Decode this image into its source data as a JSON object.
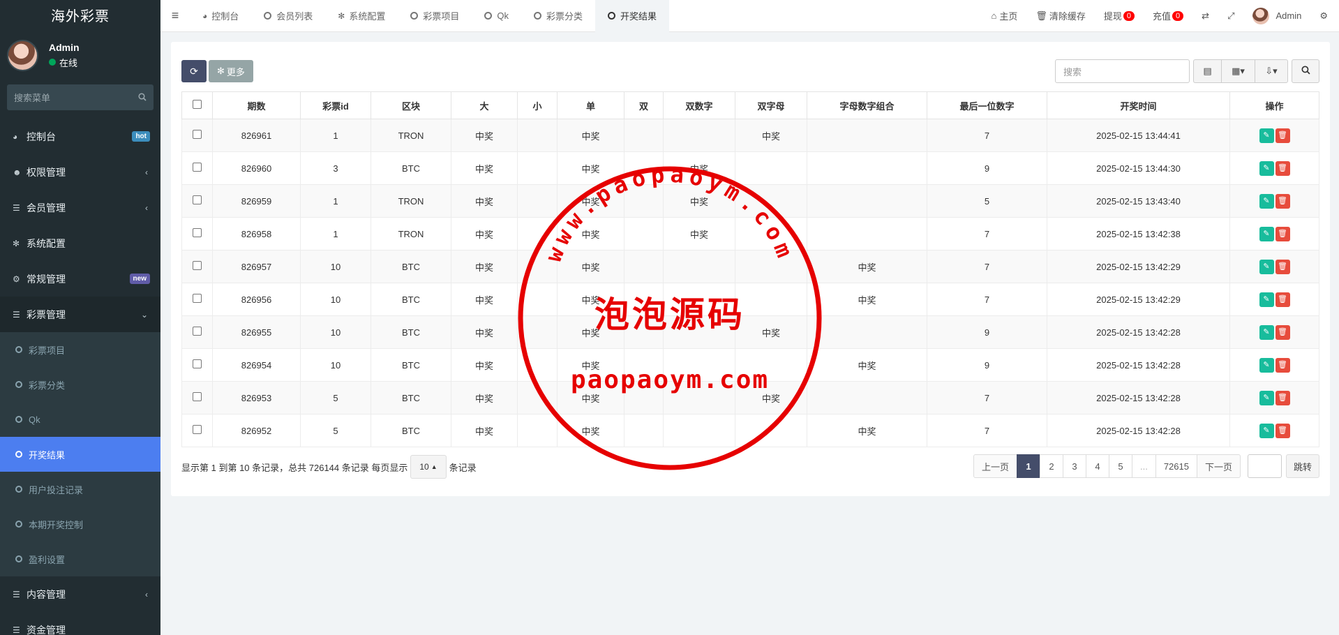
{
  "app": {
    "title": "海外彩票"
  },
  "user": {
    "name": "Admin",
    "status": "在线"
  },
  "sidebar": {
    "search_placeholder": "搜索菜单",
    "items": [
      {
        "label": "控制台",
        "icon": "dashboard-icon",
        "badge": "hot"
      },
      {
        "label": "权限管理",
        "icon": "users-icon",
        "arrow": "‹"
      },
      {
        "label": "会员管理",
        "icon": "list-icon",
        "arrow": "‹"
      },
      {
        "label": "系统配置",
        "icon": "gear-icon"
      },
      {
        "label": "常规管理",
        "icon": "cogs-icon",
        "badge": "new"
      },
      {
        "label": "彩票管理",
        "icon": "list-icon",
        "arrow": "⌄"
      }
    ],
    "sub_items": [
      {
        "label": "彩票项目"
      },
      {
        "label": "彩票分类"
      },
      {
        "label": "Qk"
      },
      {
        "label": "开奖结果"
      },
      {
        "label": "用户投注记录"
      },
      {
        "label": "本期开奖控制"
      },
      {
        "label": "盈利设置"
      }
    ],
    "bottom_items": [
      {
        "label": "内容管理",
        "icon": "list-icon",
        "arrow": "‹"
      },
      {
        "label": "资金管理",
        "icon": "list-icon"
      }
    ]
  },
  "topnav": {
    "tabs": [
      {
        "label": "控制台",
        "icon": "dashboard-icon"
      },
      {
        "label": "会员列表"
      },
      {
        "label": "系统配置",
        "icon": "gear-icon"
      },
      {
        "label": "彩票项目"
      },
      {
        "label": "Qk"
      },
      {
        "label": "彩票分类"
      },
      {
        "label": "开奖结果"
      }
    ],
    "right": {
      "home": "主页",
      "clear_cache": "清除缓存",
      "withdraw": "提现",
      "withdraw_count": "0",
      "recharge": "充值",
      "recharge_count": "0",
      "user": "Admin"
    }
  },
  "toolbar": {
    "more": "更多",
    "search_placeholder": "搜索"
  },
  "table": {
    "headers": [
      "期数",
      "彩票id",
      "区块",
      "大",
      "小",
      "单",
      "双",
      "双数字",
      "双字母",
      "字母数字组合",
      "最后一位数字",
      "开奖时间",
      "操作"
    ],
    "rows": [
      [
        "826961",
        "1",
        "TRON",
        "中奖",
        "",
        "中奖",
        "",
        "",
        "中奖",
        "",
        "7",
        "2025-02-15 13:44:41"
      ],
      [
        "826960",
        "3",
        "BTC",
        "中奖",
        "",
        "中奖",
        "",
        "中奖",
        "",
        "",
        "9",
        "2025-02-15 13:44:30"
      ],
      [
        "826959",
        "1",
        "TRON",
        "中奖",
        "",
        "中奖",
        "",
        "中奖",
        "",
        "",
        "5",
        "2025-02-15 13:43:40"
      ],
      [
        "826958",
        "1",
        "TRON",
        "中奖",
        "",
        "中奖",
        "",
        "中奖",
        "",
        "",
        "7",
        "2025-02-15 13:42:38"
      ],
      [
        "826957",
        "10",
        "BTC",
        "中奖",
        "",
        "中奖",
        "",
        "",
        "",
        "中奖",
        "7",
        "2025-02-15 13:42:29"
      ],
      [
        "826956",
        "10",
        "BTC",
        "中奖",
        "",
        "中奖",
        "",
        "",
        "",
        "中奖",
        "7",
        "2025-02-15 13:42:29"
      ],
      [
        "826955",
        "10",
        "BTC",
        "中奖",
        "",
        "中奖",
        "",
        "",
        "中奖",
        "",
        "9",
        "2025-02-15 13:42:28"
      ],
      [
        "826954",
        "10",
        "BTC",
        "中奖",
        "",
        "中奖",
        "",
        "",
        "",
        "中奖",
        "9",
        "2025-02-15 13:42:28"
      ],
      [
        "826953",
        "5",
        "BTC",
        "中奖",
        "",
        "中奖",
        "",
        "",
        "中奖",
        "",
        "7",
        "2025-02-15 13:42:28"
      ],
      [
        "826952",
        "5",
        "BTC",
        "中奖",
        "",
        "中奖",
        "",
        "",
        "",
        "中奖",
        "7",
        "2025-02-15 13:42:28"
      ]
    ]
  },
  "pager": {
    "info": "显示第 1 到第 10 条记录，总共 726144 条记录 每页显示",
    "page_size": "10",
    "suffix": "条记录",
    "prev": "上一页",
    "pages": [
      "1",
      "2",
      "3",
      "4",
      "5",
      "...",
      "72615"
    ],
    "next": "下一页",
    "jump": "跳转"
  },
  "watermark": {
    "arc_text": "www.paopaoym.com",
    "center_text": "泡泡源码",
    "bottom_text": "paopaoym.com"
  },
  "colors": {
    "sidebar_bg": "#222d32",
    "active_menu": "#4c7ef0",
    "primary_btn": "#444d6a",
    "edit": "#18bc9c",
    "delete": "#e74c3c",
    "stamp": "#e60000"
  }
}
